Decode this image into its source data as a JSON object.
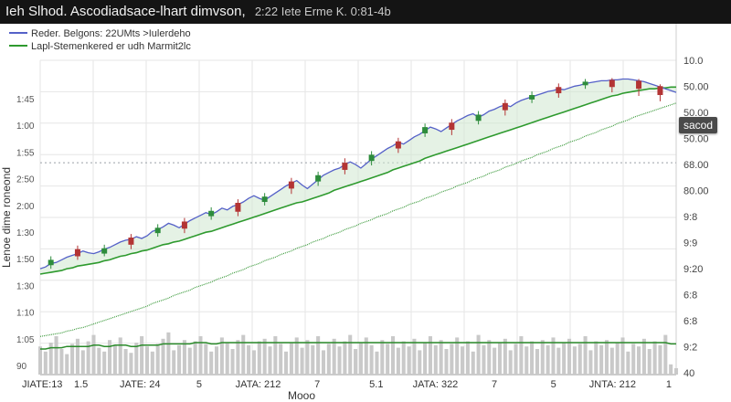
{
  "window": {
    "title": "Ieh Slhod. Ascodiadsace-lhart dimvson,",
    "subtitle": "2:22 Iete Erme K. 0:81-4b"
  },
  "tooltip": {
    "label": "sacod"
  },
  "colors": {
    "price_line": "#5561c8",
    "ma_line": "#2e9a2e",
    "trend_line": "#3c9a3c",
    "candle_up": "#2d8c3c",
    "candle_down": "#b33434",
    "volume_bar": "#c9c9c9",
    "volume_line": "#2a8a2a",
    "grid": "#e6e6e6",
    "ref_line": "#9aa0a6"
  },
  "chart_data": {
    "type": "line",
    "title": "",
    "ylabel": "Lenoe dime roneond",
    "xlabel": "Mooo",
    "legend_position": "top-left",
    "legend": [
      {
        "label": "Reder. Belgons: 22UMts >Iulerdeho",
        "series": "price"
      },
      {
        "label": "Lapl-Stemenkered er udh Marmit2lc",
        "series": "moving-average"
      }
    ],
    "left_ticks": [
      "1:45",
      "1:00",
      "1:55",
      "2:50",
      "2:00",
      "1:30",
      "1:50",
      "1:30",
      "1:10",
      "1:05",
      "90"
    ],
    "right_ticks": [
      "10.0",
      "50.00",
      "50.00",
      "50.00",
      "68.00",
      "80.00",
      "9:8",
      "9:9",
      "9:20",
      "6:8",
      "6:8",
      "9:2",
      "40"
    ],
    "x_ticks": [
      "JIATE:13",
      "1.5",
      "JATE: 24",
      "5",
      "JATA: 212",
      "7",
      "5.1",
      "JATA: 322",
      "7",
      "5",
      "JNTA: 212",
      "1"
    ],
    "reference_line_label": "",
    "x": [
      1,
      2,
      3,
      4,
      5,
      6,
      7,
      8,
      9,
      10,
      11,
      12,
      13,
      14,
      15,
      16,
      17,
      18,
      19,
      20,
      21,
      22,
      23,
      24,
      25,
      26,
      27,
      28,
      29,
      30,
      31,
      32,
      33,
      34,
      35,
      36,
      37,
      38,
      39,
      40,
      41,
      42,
      43,
      44,
      45,
      46,
      47,
      48,
      49,
      50,
      51,
      52,
      53,
      54,
      55,
      56,
      57,
      58,
      59,
      60,
      61,
      62,
      63,
      64,
      65,
      66,
      67,
      68,
      69,
      70,
      71,
      72,
      73,
      74,
      75,
      76,
      77,
      78,
      79,
      80,
      81,
      82,
      83,
      84,
      85,
      86,
      87,
      88,
      89,
      90,
      91,
      92,
      93,
      94,
      95,
      96,
      97,
      98,
      99,
      100,
      101,
      102,
      103,
      104,
      105,
      106,
      107,
      108,
      109,
      110,
      111,
      112,
      113,
      114,
      115,
      116,
      117,
      118,
      119,
      120
    ],
    "series": [
      {
        "key": "price",
        "values": [
          86,
          88,
          92,
          93,
          96,
          99,
          101,
          103,
          106,
          104,
          103,
          105,
          108,
          110,
          113,
          116,
          118,
          119,
          122,
          120,
          123,
          128,
          130,
          133,
          137,
          135,
          132,
          136,
          140,
          143,
          146,
          149,
          147,
          150,
          154,
          152,
          156,
          158,
          161,
          165,
          168,
          165,
          163,
          167,
          171,
          175,
          179,
          182,
          185,
          180,
          176,
          181,
          186,
          191,
          194,
          197,
          199,
          203,
          206,
          203,
          199,
          204,
          209,
          213,
          217,
          221,
          224,
          228,
          226,
          230,
          234,
          237,
          241,
          245,
          243,
          240,
          244,
          248,
          252,
          255,
          258,
          260,
          256,
          259,
          263,
          265,
          268,
          270,
          268,
          272,
          275,
          277,
          279,
          281,
          283,
          285,
          286,
          288,
          287,
          289,
          291,
          292,
          294,
          295,
          296,
          297,
          297,
          298,
          298,
          299,
          299,
          298,
          297,
          296,
          294,
          292,
          290,
          288,
          286,
          284
        ]
      },
      {
        "key": "moving-average",
        "values": [
          80,
          81,
          82,
          83,
          84,
          86,
          87,
          89,
          90,
          91,
          92,
          93,
          95,
          96,
          98,
          100,
          101,
          103,
          104,
          106,
          107,
          109,
          111,
          113,
          114,
          116,
          117,
          119,
          121,
          123,
          125,
          127,
          128,
          130,
          132,
          134,
          136,
          138,
          140,
          142,
          144,
          146,
          148,
          150,
          152,
          154,
          156,
          158,
          160,
          161,
          163,
          165,
          167,
          169,
          171,
          174,
          176,
          178,
          180,
          182,
          184,
          186,
          188,
          190,
          192,
          194,
          197,
          199,
          201,
          203,
          205,
          207,
          210,
          212,
          214,
          216,
          218,
          220,
          222,
          224,
          226,
          228,
          230,
          232,
          234,
          236,
          238,
          240,
          242,
          244,
          246,
          248,
          250,
          252,
          254,
          256,
          258,
          260,
          262,
          264,
          266,
          268,
          270,
          272,
          274,
          276,
          278,
          280,
          281,
          283,
          284,
          285,
          286,
          287,
          288,
          288,
          289,
          289,
          290,
          290
        ]
      },
      {
        "key": "trend",
        "values": [
          10,
          11,
          12,
          13,
          14,
          16,
          17,
          19,
          20,
          22,
          24,
          26,
          28,
          30,
          32,
          34,
          36,
          38,
          40,
          42,
          44,
          47,
          49,
          51,
          53,
          56,
          58,
          60,
          62,
          65,
          67,
          69,
          71,
          74,
          76,
          78,
          81,
          83,
          85,
          88,
          90,
          92,
          95,
          97,
          99,
          102,
          104,
          106,
          109,
          111,
          113,
          116,
          118,
          120,
          123,
          125,
          127,
          130,
          132,
          134,
          137,
          139,
          141,
          144,
          146,
          148,
          151,
          153,
          155,
          158,
          160,
          162,
          165,
          167,
          169,
          172,
          174,
          176,
          179,
          181,
          183,
          186,
          188,
          190,
          193,
          195,
          197,
          200,
          202,
          204,
          207,
          209,
          211,
          214,
          216,
          218,
          221,
          223,
          225,
          228,
          230,
          232,
          235,
          237,
          239,
          242,
          244,
          246,
          249,
          251,
          253,
          256,
          258,
          260,
          262,
          264,
          266,
          268,
          270,
          272
        ]
      }
    ],
    "candles": [
      {
        "x": 3,
        "dir": "up",
        "open": 90,
        "close": 96,
        "high": 100,
        "low": 86
      },
      {
        "x": 8,
        "dir": "down",
        "open": 108,
        "close": 100,
        "high": 112,
        "low": 96
      },
      {
        "x": 13,
        "dir": "up",
        "open": 103,
        "close": 109,
        "high": 113,
        "low": 100
      },
      {
        "x": 18,
        "dir": "down",
        "open": 121,
        "close": 113,
        "high": 125,
        "low": 108
      },
      {
        "x": 23,
        "dir": "up",
        "open": 126,
        "close": 132,
        "high": 136,
        "low": 122
      },
      {
        "x": 28,
        "dir": "down",
        "open": 139,
        "close": 131,
        "high": 143,
        "low": 126
      },
      {
        "x": 33,
        "dir": "up",
        "open": 145,
        "close": 151,
        "high": 155,
        "low": 141
      },
      {
        "x": 38,
        "dir": "down",
        "open": 160,
        "close": 150,
        "high": 164,
        "low": 145
      },
      {
        "x": 43,
        "dir": "up",
        "open": 161,
        "close": 167,
        "high": 171,
        "low": 157
      },
      {
        "x": 48,
        "dir": "down",
        "open": 184,
        "close": 176,
        "high": 188,
        "low": 170
      },
      {
        "x": 53,
        "dir": "up",
        "open": 184,
        "close": 191,
        "high": 195,
        "low": 179
      },
      {
        "x": 58,
        "dir": "down",
        "open": 205,
        "close": 197,
        "high": 210,
        "low": 192
      },
      {
        "x": 63,
        "dir": "up",
        "open": 207,
        "close": 214,
        "high": 218,
        "low": 202
      },
      {
        "x": 68,
        "dir": "down",
        "open": 229,
        "close": 221,
        "high": 233,
        "low": 216
      },
      {
        "x": 73,
        "dir": "up",
        "open": 238,
        "close": 245,
        "high": 249,
        "low": 234
      },
      {
        "x": 78,
        "dir": "down",
        "open": 250,
        "close": 242,
        "high": 254,
        "low": 236
      },
      {
        "x": 83,
        "dir": "up",
        "open": 252,
        "close": 259,
        "high": 263,
        "low": 248
      },
      {
        "x": 88,
        "dir": "down",
        "open": 272,
        "close": 264,
        "high": 276,
        "low": 258
      },
      {
        "x": 93,
        "dir": "up",
        "open": 276,
        "close": 281,
        "high": 285,
        "low": 272
      },
      {
        "x": 98,
        "dir": "down",
        "open": 290,
        "close": 283,
        "high": 294,
        "low": 278
      },
      {
        "x": 103,
        "dir": "up",
        "open": 292,
        "close": 296,
        "high": 299,
        "low": 288
      },
      {
        "x": 108,
        "dir": "down",
        "open": 298,
        "close": 290,
        "high": 300,
        "low": 284
      },
      {
        "x": 113,
        "dir": "down",
        "open": 297,
        "close": 288,
        "high": 299,
        "low": 280
      },
      {
        "x": 117,
        "dir": "down",
        "open": 291,
        "close": 281,
        "high": 293,
        "low": 274
      }
    ],
    "volume": [
      22,
      18,
      25,
      30,
      20,
      16,
      24,
      28,
      19,
      26,
      31,
      21,
      18,
      27,
      23,
      29,
      20,
      17,
      25,
      30,
      22,
      18,
      24,
      28,
      33,
      19,
      23,
      27,
      21,
      26,
      30,
      24,
      18,
      22,
      29,
      25,
      20,
      27,
      31,
      23,
      19,
      26,
      28,
      22,
      30,
      24,
      18,
      25,
      29,
      21,
      27,
      23,
      30,
      19,
      24,
      28,
      22,
      26,
      31,
      20,
      25,
      29,
      23,
      18,
      27,
      24,
      30,
      21,
      26,
      22,
      28,
      19,
      25,
      30,
      23,
      27,
      20,
      24,
      29,
      22,
      26,
      18,
      31,
      23,
      27,
      21,
      25,
      28,
      19,
      24,
      30,
      22,
      26,
      20,
      27,
      23,
      29,
      21,
      25,
      28,
      22,
      24,
      30,
      19,
      26,
      23,
      27,
      21,
      25,
      29,
      18,
      24,
      22,
      28,
      20,
      26,
      23,
      31,
      8,
      5
    ],
    "volume_ma": [
      20,
      20,
      21,
      21,
      21,
      22,
      22,
      22,
      22,
      22,
      23,
      23,
      22,
      22,
      23,
      23,
      23,
      22,
      22,
      23,
      23,
      23,
      23,
      24,
      24,
      24,
      24,
      24,
      24,
      25,
      25,
      25,
      24,
      24,
      25,
      25,
      25,
      25,
      25,
      25,
      25,
      25,
      25,
      25,
      25,
      25,
      25,
      25,
      25,
      25,
      25,
      25,
      25,
      25,
      25,
      25,
      25,
      25,
      25,
      25,
      25,
      25,
      25,
      25,
      25,
      25,
      25,
      25,
      25,
      25,
      25,
      25,
      25,
      25,
      25,
      25,
      25,
      25,
      25,
      25,
      25,
      25,
      25,
      25,
      25,
      25,
      25,
      25,
      25,
      25,
      25,
      25,
      25,
      25,
      25,
      25,
      25,
      25,
      25,
      25,
      25,
      25,
      25,
      25,
      25,
      25,
      25,
      25,
      25,
      25,
      25,
      25,
      25,
      25,
      25,
      25,
      25,
      25,
      24,
      24
    ],
    "y_range": [
      0,
      320
    ],
    "volume_range": [
      0,
      60
    ],
    "reference_level": 205,
    "grid": true
  }
}
